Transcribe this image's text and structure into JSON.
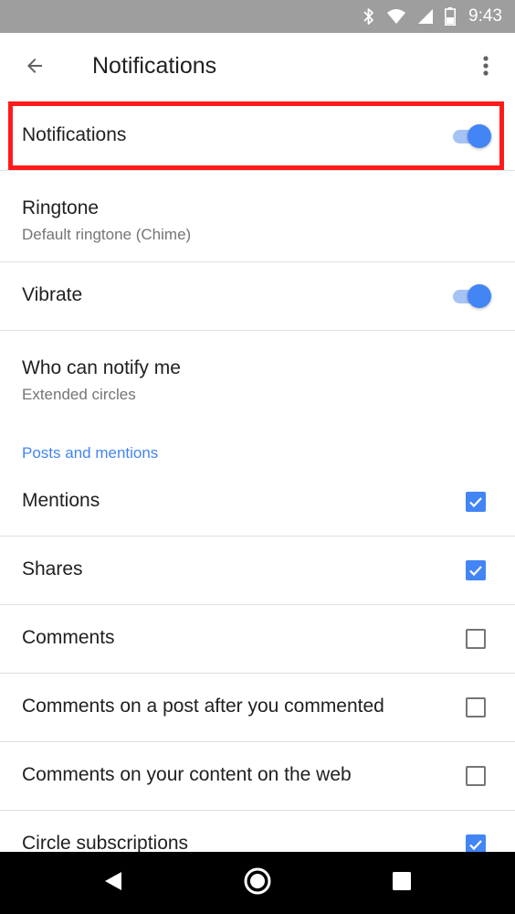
{
  "status_bar": {
    "time": "9:43",
    "icons": [
      "bluetooth-icon",
      "wifi-icon",
      "cellular-icon",
      "battery-icon"
    ]
  },
  "app_bar": {
    "title": "Notifications",
    "back_icon": "arrow-back-icon",
    "overflow_icon": "more-vert-icon"
  },
  "settings": {
    "notifications": {
      "title": "Notifications",
      "enabled": true
    },
    "ringtone": {
      "title": "Ringtone",
      "subtitle": "Default ringtone (Chime)"
    },
    "vibrate": {
      "title": "Vibrate",
      "enabled": true
    },
    "who_can_notify": {
      "title": "Who can notify me",
      "subtitle": "Extended circles"
    }
  },
  "posts_section": {
    "header": "Posts and mentions",
    "items": [
      {
        "label": "Mentions",
        "checked": true
      },
      {
        "label": "Shares",
        "checked": true
      },
      {
        "label": "Comments",
        "checked": false
      },
      {
        "label": "Comments on a post after you commented",
        "checked": false
      },
      {
        "label": "Comments on your content on the web",
        "checked": false
      },
      {
        "label": "Circle subscriptions",
        "checked": true
      }
    ]
  },
  "nav_bar": {
    "back_icon": "nav-back-icon",
    "home_icon": "nav-home-icon",
    "recents_icon": "nav-recents-icon"
  },
  "colors": {
    "accent": "#4285f4",
    "highlight": "#ff1a1a",
    "status_bar": "#9e9e9e"
  }
}
